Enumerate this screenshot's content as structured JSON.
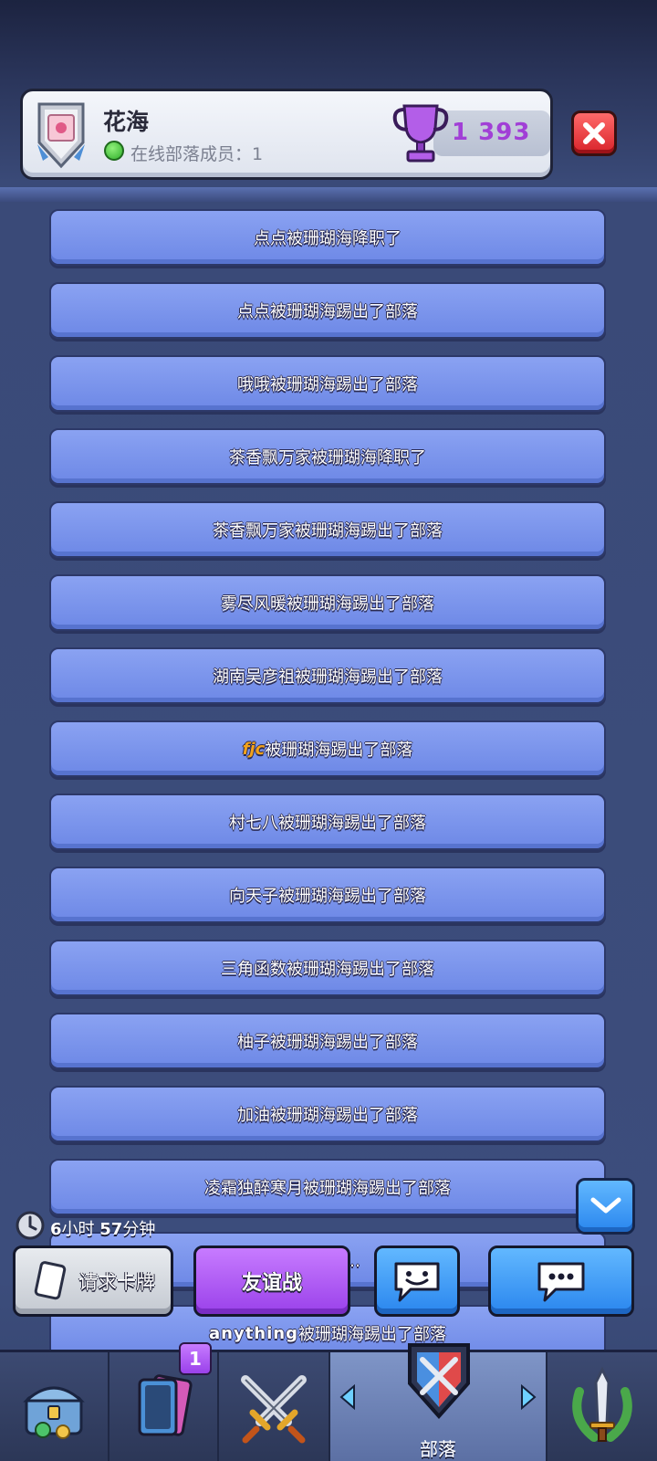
{
  "clan": {
    "name": "花海",
    "online_text": "在线部落成员：1",
    "trophies": "1 393"
  },
  "log": [
    {
      "text": "点点被珊瑚海降职了"
    },
    {
      "text": "点点被珊瑚海踢出了部落"
    },
    {
      "text": "哦哦被珊瑚海踢出了部落"
    },
    {
      "text": "茶香飘万家被珊瑚海降职了"
    },
    {
      "text": "茶香飘万家被珊瑚海踢出了部落"
    },
    {
      "text": "雾尽风暖被珊瑚海踢出了部落"
    },
    {
      "text": "湖南吴彦祖被珊瑚海踢出了部落"
    },
    {
      "prefix": "fjc",
      "text": "被珊瑚海踢出了部落"
    },
    {
      "text": "村七八被珊瑚海踢出了部落"
    },
    {
      "text": "向天子被珊瑚海踢出了部落"
    },
    {
      "text": "三角函数被珊瑚海踢出了部落"
    },
    {
      "text": "柚子被珊瑚海踢出了部落"
    },
    {
      "text": "加油被珊瑚海踢出了部落"
    },
    {
      "text": "凌霜独醉寒月被珊瑚海踢出了部落"
    },
    {
      "text": "…踢出…"
    },
    {
      "prefix": "anything",
      "text": "被珊瑚海踢出了部落"
    }
  ],
  "timer": {
    "hours": "6",
    "hours_unit": "小时",
    "minutes": "57",
    "minutes_unit": "分钟"
  },
  "actions": {
    "request_cards": "请求卡牌",
    "friendly_battle": "友谊战"
  },
  "nav": {
    "cards_badge": "1",
    "clan_label": "部落"
  },
  "colors": {
    "log_item_bg": "#7b95ee",
    "friendly_btn": "#a94cf0",
    "blue_btn": "#3a98f5",
    "close_btn": "#e33038",
    "trophy_text": "#a13fd6"
  }
}
